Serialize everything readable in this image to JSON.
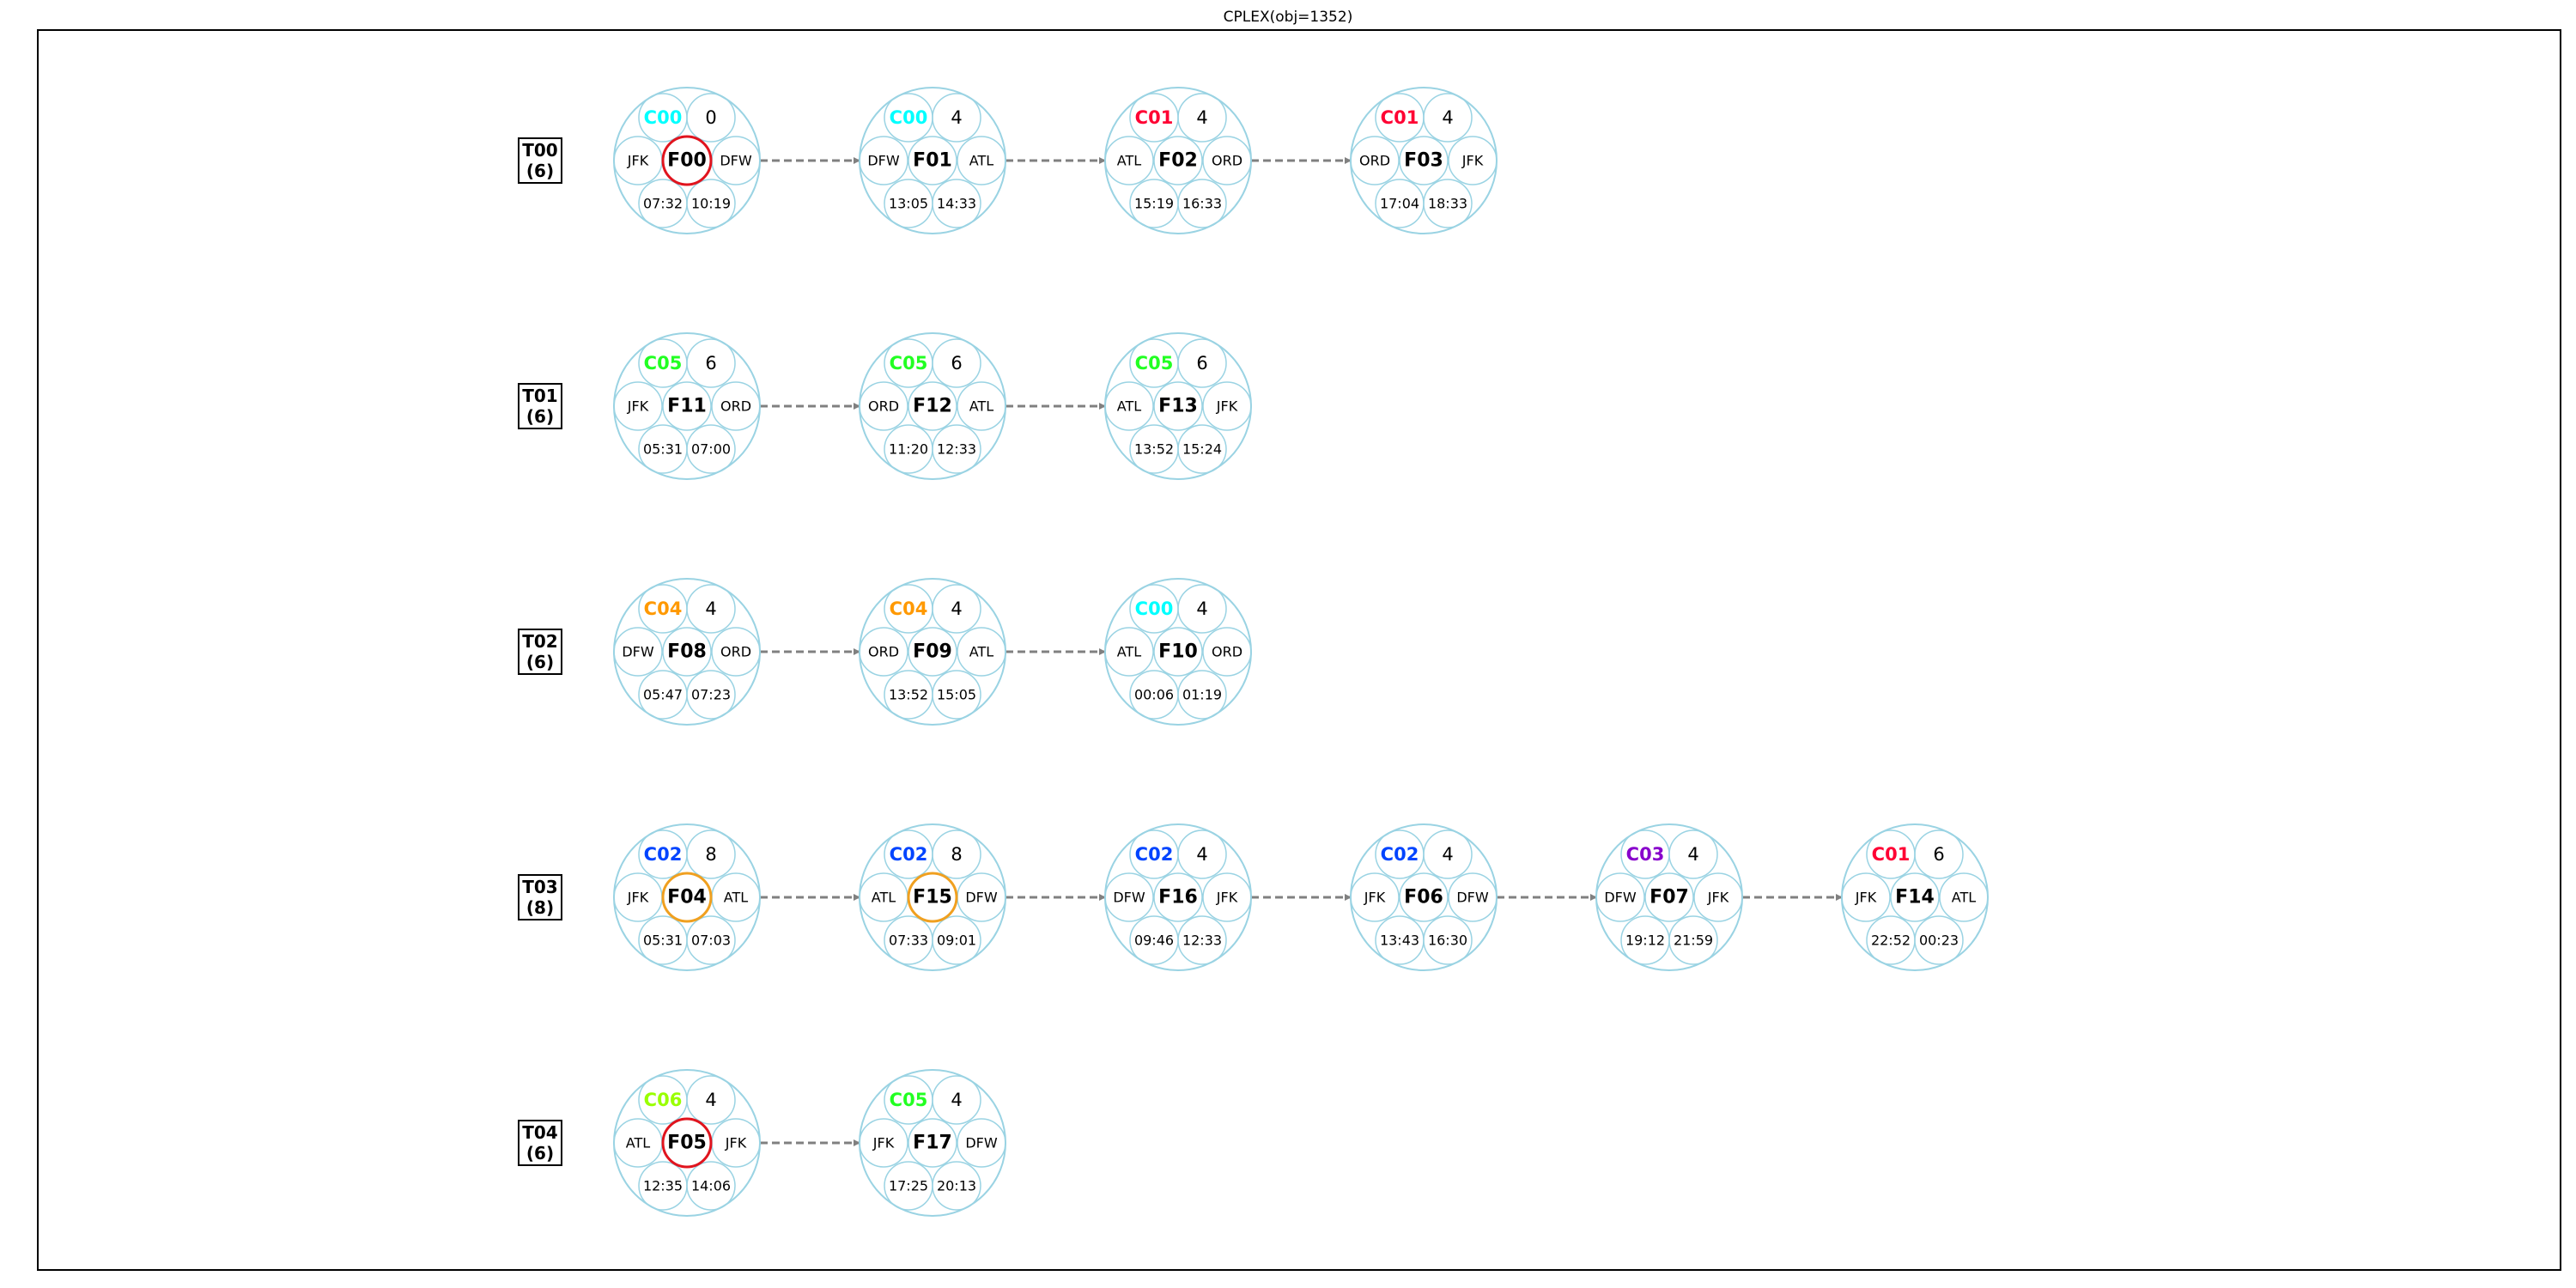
{
  "title": "CPLEX(obj=1352)",
  "colors": {
    "circle_stroke": "#9ad3e3",
    "arrow": "#808080",
    "red_highlight": "#e0141e",
    "orange_highlight": "#f0a020",
    "C00": "#00ffff",
    "C01": "#ff0033",
    "C02": "#0044ff",
    "C03": "#8800cc",
    "C04": "#ff9900",
    "C05": "#22ff22",
    "C06": "#99ff00"
  },
  "tails": [
    {
      "id": "T00",
      "count": "(6)",
      "flights": [
        {
          "flight": "F00",
          "crew": "C00",
          "value": "0",
          "origin": "JFK",
          "dest": "DFW",
          "dep": "07:32",
          "arr": "10:19",
          "highlight": "red"
        },
        {
          "flight": "F01",
          "crew": "C00",
          "value": "4",
          "origin": "DFW",
          "dest": "ATL",
          "dep": "13:05",
          "arr": "14:33",
          "highlight": ""
        },
        {
          "flight": "F02",
          "crew": "C01",
          "value": "4",
          "origin": "ATL",
          "dest": "ORD",
          "dep": "15:19",
          "arr": "16:33",
          "highlight": ""
        },
        {
          "flight": "F03",
          "crew": "C01",
          "value": "4",
          "origin": "ORD",
          "dest": "JFK",
          "dep": "17:04",
          "arr": "18:33",
          "highlight": ""
        }
      ]
    },
    {
      "id": "T01",
      "count": "(6)",
      "flights": [
        {
          "flight": "F11",
          "crew": "C05",
          "value": "6",
          "origin": "JFK",
          "dest": "ORD",
          "dep": "05:31",
          "arr": "07:00",
          "highlight": ""
        },
        {
          "flight": "F12",
          "crew": "C05",
          "value": "6",
          "origin": "ORD",
          "dest": "ATL",
          "dep": "11:20",
          "arr": "12:33",
          "highlight": ""
        },
        {
          "flight": "F13",
          "crew": "C05",
          "value": "6",
          "origin": "ATL",
          "dest": "JFK",
          "dep": "13:52",
          "arr": "15:24",
          "highlight": ""
        }
      ]
    },
    {
      "id": "T02",
      "count": "(6)",
      "flights": [
        {
          "flight": "F08",
          "crew": "C04",
          "value": "4",
          "origin": "DFW",
          "dest": "ORD",
          "dep": "05:47",
          "arr": "07:23",
          "highlight": ""
        },
        {
          "flight": "F09",
          "crew": "C04",
          "value": "4",
          "origin": "ORD",
          "dest": "ATL",
          "dep": "13:52",
          "arr": "15:05",
          "highlight": ""
        },
        {
          "flight": "F10",
          "crew": "C00",
          "value": "4",
          "origin": "ATL",
          "dest": "ORD",
          "dep": "00:06",
          "arr": "01:19",
          "highlight": ""
        }
      ]
    },
    {
      "id": "T03",
      "count": "(8)",
      "flights": [
        {
          "flight": "F04",
          "crew": "C02",
          "value": "8",
          "origin": "JFK",
          "dest": "ATL",
          "dep": "05:31",
          "arr": "07:03",
          "highlight": "orange"
        },
        {
          "flight": "F15",
          "crew": "C02",
          "value": "8",
          "origin": "ATL",
          "dest": "DFW",
          "dep": "07:33",
          "arr": "09:01",
          "highlight": "orange"
        },
        {
          "flight": "F16",
          "crew": "C02",
          "value": "4",
          "origin": "DFW",
          "dest": "JFK",
          "dep": "09:46",
          "arr": "12:33",
          "highlight": ""
        },
        {
          "flight": "F06",
          "crew": "C02",
          "value": "4",
          "origin": "JFK",
          "dest": "DFW",
          "dep": "13:43",
          "arr": "16:30",
          "highlight": ""
        },
        {
          "flight": "F07",
          "crew": "C03",
          "value": "4",
          "origin": "DFW",
          "dest": "JFK",
          "dep": "19:12",
          "arr": "21:59",
          "highlight": ""
        },
        {
          "flight": "F14",
          "crew": "C01",
          "value": "6",
          "origin": "JFK",
          "dest": "ATL",
          "dep": "22:52",
          "arr": "00:23",
          "highlight": ""
        }
      ]
    },
    {
      "id": "T04",
      "count": "(6)",
      "flights": [
        {
          "flight": "F05",
          "crew": "C06",
          "value": "4",
          "origin": "ATL",
          "dest": "JFK",
          "dep": "12:35",
          "arr": "14:06",
          "highlight": "red"
        },
        {
          "flight": "F17",
          "crew": "C05",
          "value": "4",
          "origin": "JFK",
          "dest": "DFW",
          "dep": "17:25",
          "arr": "20:13",
          "highlight": ""
        }
      ]
    }
  ]
}
